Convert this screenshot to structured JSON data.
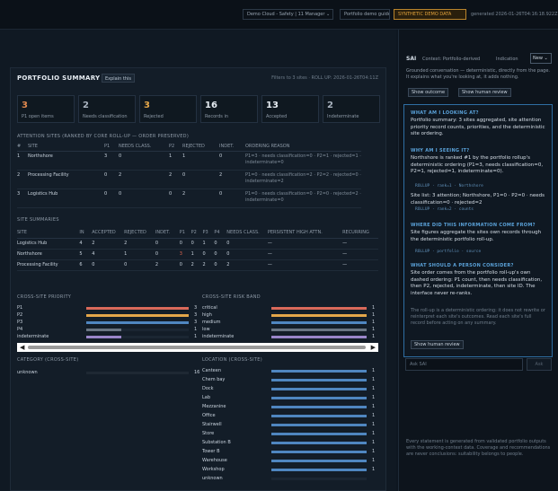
{
  "topbar": {
    "chips": [
      {
        "label": "Demo Cloud - Safety | 11 Manager ⌄",
        "left": 0
      },
      {
        "label": "Portfolio demo guide"
      },
      {
        "label": "SYNTHETIC DEMO DATA"
      }
    ],
    "timestamp": "generated 2026-01-26T04:16:18.922Z"
  },
  "summary": {
    "title": "PORTFOLIO SUMMARY",
    "explain_label": "Explain this",
    "hint": "Filters to 3 sites · ROLL UP: 2026-01-26T04:11Z",
    "cards": [
      {
        "value": "3",
        "label": "P1 open items",
        "color": "#e0894f"
      },
      {
        "value": "2",
        "label": "Needs classification",
        "color": "#aab4c0"
      },
      {
        "value": "3",
        "label": "Rejected",
        "color": "#e3a64a"
      },
      {
        "value": "16",
        "label": "Records in",
        "color": "#e7edf3"
      },
      {
        "value": "13",
        "label": "Accepted",
        "color": "#e7edf3"
      },
      {
        "value": "2",
        "label": "Indeterminate",
        "color": "#aab4c0"
      }
    ]
  },
  "attention": {
    "heading": "ATTENTION SITES (RANKED BY CORE ROLL-UP — ORDER PRESERVED)",
    "columns": [
      "#",
      "SITE",
      "P1",
      "NEEDS CLASS.",
      "P2",
      "REJECTED",
      "INDET.",
      "ORDERING REASON"
    ],
    "rows": [
      {
        "rank": "1",
        "site": "Northshore",
        "p1": "3",
        "needs": "0",
        "p2": "1",
        "rejected": "1",
        "indet": "0",
        "reason": "P1=3 · needs classification=0 · P2=1 · rejected=1 · indeterminate=0"
      },
      {
        "rank": "2",
        "site": "Processing Facility",
        "p1": "0",
        "needs": "2",
        "p2": "2",
        "rejected": "0",
        "indet": "2",
        "reason": "P1=0 · needs classification=2 · P2=2 · rejected=0 · indeterminate=2"
      },
      {
        "rank": "3",
        "site": "Logistics Hub",
        "p1": "0",
        "needs": "0",
        "p2": "0",
        "rejected": "2",
        "indet": "0",
        "reason": "P1=0 · needs classification=0 · P2=0 · rejected=2 · indeterminate=0"
      }
    ]
  },
  "site_summaries": {
    "heading": "SITE SUMMARIES",
    "columns": [
      "SITE",
      "IN",
      "ACCEPTED",
      "REJECTED",
      "INDET.",
      "P1",
      "P2",
      "P3",
      "P4",
      "NEEDS CLASS.",
      "PERSISTENT HIGH ATTN.",
      "RECURRING"
    ],
    "rows": [
      {
        "site": "Logistics Hub",
        "in": "4",
        "accepted": "2",
        "rejected": "2",
        "indet": "0",
        "p1": "0",
        "p2": "0",
        "p3": "1",
        "p4": "0",
        "needs": "0",
        "persistent": "—",
        "recurring": "—"
      },
      {
        "site": "Northshore",
        "in": "5",
        "accepted": "4",
        "rejected": "1",
        "indet": "0",
        "p1": "3",
        "p2": "1",
        "p3": "0",
        "p4": "0",
        "needs": "0",
        "persistent": "—",
        "recurring": "—"
      },
      {
        "site": "Processing Facility",
        "in": "6",
        "accepted": "0",
        "rejected": "0",
        "indet": "2",
        "p1": "0",
        "p2": "2",
        "p3": "2",
        "p4": "0",
        "needs": "2",
        "persistent": "—",
        "recurring": "—"
      }
    ]
  },
  "priority": {
    "heading": "CROSS-SITE PRIORITY",
    "items": [
      {
        "label": "P1",
        "value": "3",
        "pct": 100,
        "color": "#d9695a"
      },
      {
        "label": "P2",
        "value": "3",
        "pct": 100,
        "color": "#e3a64a"
      },
      {
        "label": "P3",
        "value": "3",
        "pct": 100,
        "color": "#4f86c0"
      },
      {
        "label": "P4",
        "value": "1",
        "pct": 34,
        "color": "#6a7583"
      },
      {
        "label": "indeterminate",
        "value": "1",
        "pct": 34,
        "color": "#9a86c9"
      }
    ]
  },
  "risk": {
    "heading": "CROSS-SITE RISK BAND",
    "items": [
      {
        "label": "critical",
        "value": "1",
        "pct": 100,
        "color": "#d9695a"
      },
      {
        "label": "high",
        "value": "1",
        "pct": 100,
        "color": "#e3a64a"
      },
      {
        "label": "medium",
        "value": "1",
        "pct": 100,
        "color": "#4f86c0"
      },
      {
        "label": "low",
        "value": "1",
        "pct": 100,
        "color": "#6a7583"
      },
      {
        "label": "indeterminate",
        "value": "1",
        "pct": 100,
        "color": "#9a86c9"
      }
    ]
  },
  "category": {
    "heading": "CATEGORY (CROSS-SITE)",
    "items": [
      {
        "label": "unknown",
        "value": "16",
        "pct": 100,
        "color": "#1e2833"
      }
    ]
  },
  "location": {
    "heading": "LOCATION (CROSS-SITE)",
    "items": [
      {
        "label": "Canteen",
        "value": "1",
        "pct": 100,
        "color": "#4f86c0"
      },
      {
        "label": "Chem bay",
        "value": "1",
        "pct": 100,
        "color": "#4f86c0"
      },
      {
        "label": "Dock",
        "value": "1",
        "pct": 100,
        "color": "#4f86c0"
      },
      {
        "label": "Lab",
        "value": "1",
        "pct": 100,
        "color": "#4f86c0"
      },
      {
        "label": "Mezzanine",
        "value": "1",
        "pct": 100,
        "color": "#4f86c0"
      },
      {
        "label": "Office",
        "value": "1",
        "pct": 100,
        "color": "#4f86c0"
      },
      {
        "label": "Stairwell",
        "value": "1",
        "pct": 100,
        "color": "#4f86c0"
      },
      {
        "label": "Store",
        "value": "1",
        "pct": 100,
        "color": "#4f86c0"
      },
      {
        "label": "Substation B",
        "value": "1",
        "pct": 100,
        "color": "#4f86c0"
      },
      {
        "label": "Tower B",
        "value": "1",
        "pct": 100,
        "color": "#4f86c0"
      },
      {
        "label": "Warehouse",
        "value": "1",
        "pct": 100,
        "color": "#4f86c0"
      },
      {
        "label": "Workshop",
        "value": "1",
        "pct": 100,
        "color": "#4f86c0"
      },
      {
        "label": "unknown",
        "value": "",
        "pct": 0,
        "color": "#4f86c0"
      }
    ]
  },
  "sai": {
    "title": "SAI",
    "context": "Context: Portfolio-derived",
    "context2": "Indication",
    "new_label": "New ⌄",
    "intro": "Grounded conversation — deterministic, directly from the page. It explains what you're looking at, it adds nothing.",
    "btn_outcome": "Show outcome",
    "btn_human": "Show human review",
    "qa": [
      {
        "q": "WHAT AM I LOOKING AT?",
        "a": "Portfolio summary: 3 sites aggregated, site attention priority record counts, priorities, and the deterministic site ordering."
      },
      {
        "q": "WHY AM I SEEING IT?",
        "a": "Northshore is ranked #1 by the portfolio rollup's deterministic ordering (P1=3, needs classification=0, P2=1, rejected=1, indeterminate=0).",
        "code": "ROLLUP · rank=1 · Northshore"
      },
      {
        "p2": "Site list: 3 attention; Northshore, P1=0 · P2=0 · needs classification=0 · rejected=2",
        "code2": "ROLLUP · rank=2 · counts"
      },
      {
        "q": "WHERE DID THIS INFORMATION COME FROM?",
        "a": "Site figures aggregate the sites own records through the deterministic portfolio roll-up.",
        "code": "ROLLUP · portfolio · source"
      },
      {
        "q": "WHAT SHOULD A PERSON CONSIDER?",
        "a": "Site order comes from the portfolio roll-up's own dashed ordering: P1 count, then needs classification, then P2, rejected, indeterminate, then site ID. The interface never re-ranks."
      }
    ],
    "muted_note": "The roll-up is a deterministic ordering: it does not rewrite or reinterpret each site's outcomes. Read each site's full record before acting on any summary.",
    "btn_review": "Show human review",
    "ask_placeholder": "Ask SAI",
    "ask_btn": "Ask",
    "footnote": "Every statement is generated from validated portfolio outputs with the working-context data. Coverage and recommendations are never conclusions: suitability belongs to people."
  }
}
